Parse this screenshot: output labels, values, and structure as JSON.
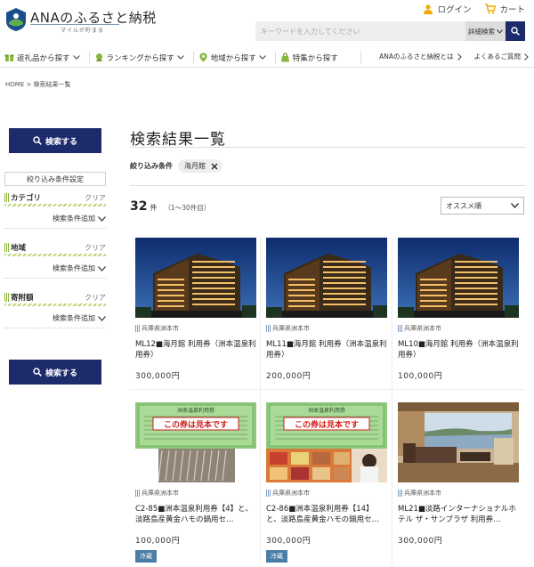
{
  "header": {
    "logo_text": "ANAのふるさと納税",
    "logo_sub": "マイルが貯まる",
    "login": "ログイン",
    "cart": "カート",
    "search_placeholder": "キーワードを入力してください",
    "detail_search": "詳細検索"
  },
  "nav": {
    "items": [
      "返礼品から探す",
      "ランキングから探す",
      "地域から探す",
      "特集から探す"
    ],
    "right": [
      "ANAのふるさと納税とは",
      "よくあるご質問"
    ]
  },
  "breadcrumb": "HOME > 検索結果一覧",
  "sidebar": {
    "search_button": "検索する",
    "filter_title": "絞り込み条件設定",
    "groups": [
      {
        "label": "カテゴリ",
        "clear": "クリア",
        "add": "検索条件追加"
      },
      {
        "label": "地域",
        "clear": "クリア",
        "add": "検索条件追加"
      },
      {
        "label": "寄附額",
        "clear": "クリア",
        "add": "検索条件追加"
      }
    ]
  },
  "main": {
    "title": "検索結果一覧",
    "condition_label": "絞り込み条件",
    "condition_chip": "海月館",
    "count": "32",
    "count_unit": "件",
    "count_range": "（1～30件目）",
    "sort": "オススメ順"
  },
  "cards": [
    {
      "loc": "兵庫県洲本市",
      "name": "ML12■海月館 利用券（洲本温泉利用券）",
      "price": "300,000円",
      "badge": "",
      "img": "hotel"
    },
    {
      "loc": "兵庫県洲本市",
      "name": "ML11■海月館 利用券（洲本温泉利用券）",
      "price": "200,000円",
      "badge": "",
      "img": "hotel"
    },
    {
      "loc": "兵庫県洲本市",
      "name": "ML10■海月館 利用券（洲本温泉利用券）",
      "price": "100,000円",
      "badge": "",
      "img": "hotel"
    },
    {
      "loc": "兵庫県洲本市",
      "name": "C2-85■洲本温泉利用券【4】と、淡路島産黄金ハモの鍋用セ…",
      "price": "100,000円",
      "badge": "冷蔵",
      "img": "ticket1"
    },
    {
      "loc": "兵庫県洲本市",
      "name": "C2-86■洲本温泉利用券【14】と、淡路島産黄金ハモの鍋用セ…",
      "price": "300,000円",
      "badge": "冷蔵",
      "img": "ticket2"
    },
    {
      "loc": "兵庫県洲本市",
      "name": "ML21■淡路インターナショナルホテル ザ・サンプラザ 利用券…",
      "price": "300,000円",
      "badge": "",
      "img": "room"
    }
  ],
  "ticket_text": {
    "title": "洲本温泉利用券",
    "stamp": "この券は見本です"
  }
}
